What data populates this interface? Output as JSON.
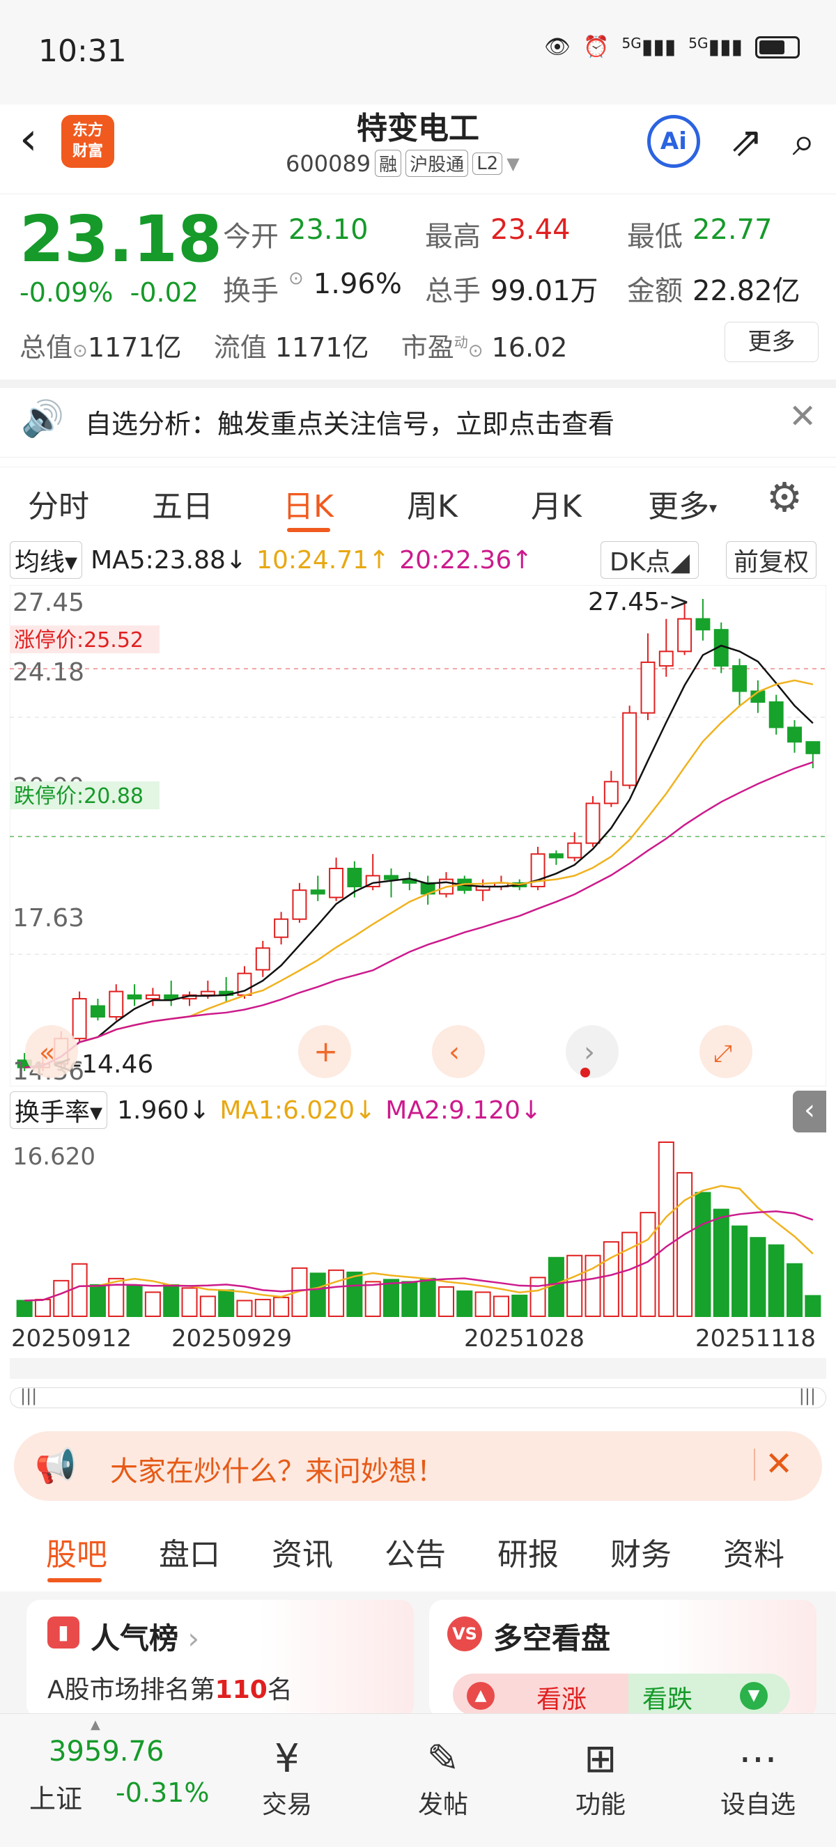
{
  "status": {
    "time": "10:31",
    "signal1": "5G",
    "signal2": "5G"
  },
  "header": {
    "logo_line1": "东方",
    "logo_line2": "财富",
    "title": "特变电工",
    "code": "600089",
    "tags": [
      "融",
      "沪股通",
      "L2"
    ],
    "ai_label": "Ai"
  },
  "quote": {
    "price": "23.18",
    "change_pct": "-0.09%",
    "change": "-0.02",
    "open_label": "今开",
    "open": "23.10",
    "high_label": "最高",
    "high": "23.44",
    "low_label": "最低",
    "low": "22.77",
    "turnover_label": "换手",
    "turnover": "1.96%",
    "volume_label": "总手",
    "volume": "99.01万",
    "amount_label": "金额",
    "amount": "22.82亿",
    "mktcap_label": "总值",
    "mktcap": "1171亿",
    "float_label": "流值",
    "float": "1171亿",
    "pe_label": "市盈",
    "pe_sup": "动",
    "pe": "16.02",
    "more_label": "更多"
  },
  "analysis": {
    "text": "自选分析：触发重点关注信号，立即点击查看"
  },
  "tabs": [
    "分时",
    "五日",
    "日K",
    "周K",
    "月K",
    "更多"
  ],
  "active_tab": "日K",
  "ma_bar": {
    "type": "均线",
    "ma5": "MA5:23.88",
    "ma10": "10:24.71",
    "ma20": "20:22.36",
    "dk": "DK点",
    "adj": "前复权"
  },
  "kchart": {
    "y_labels": [
      "27.45",
      "24.18",
      "20.90",
      "17.63",
      "14.36"
    ],
    "limit_up": "涨停价:25.52",
    "limit_down": "跌停价:20.88",
    "max_marker": "27.45->",
    "min_marker": "<-14.46",
    "colors": {
      "up": "#e02020",
      "down": "#17a22b",
      "ma5": "#111111",
      "ma10": "#f0b21e",
      "ma20": "#cc1a8c"
    }
  },
  "volume": {
    "type": "换手率",
    "value": "1.960",
    "ma1": "MA1:6.020",
    "ma2": "MA2:9.120",
    "max_label": "16.620"
  },
  "dates": [
    "20250912",
    "20250929",
    "20251028",
    "20251118"
  ],
  "banner": {
    "text": "大家在炒什么？来问妙想！"
  },
  "guba_tabs": [
    "股吧",
    "盘口",
    "资讯",
    "公告",
    "研报",
    "财务",
    "资料"
  ],
  "cards": {
    "popularity": {
      "title": "人气榜",
      "text_prefix": "A股市场排名第",
      "rank": "110",
      "text_suffix": "名"
    },
    "duokong": {
      "title": "多空看盘",
      "up": "看涨",
      "down": "看跌"
    }
  },
  "bottom": {
    "index_value": "3959.76",
    "index_name": "上证",
    "index_change": "-0.31%",
    "items": [
      "交易",
      "发帖",
      "功能",
      "设自选"
    ]
  },
  "chart_data": {
    "type": "candlestick",
    "candles": [
      [
        14.7,
        14.5,
        14.9,
        14.4
      ],
      [
        14.5,
        14.6,
        14.8,
        14.4
      ],
      [
        14.6,
        15.3,
        15.5,
        14.5
      ],
      [
        15.3,
        16.4,
        16.6,
        15.2
      ],
      [
        16.2,
        15.9,
        16.4,
        15.8
      ],
      [
        15.9,
        16.6,
        16.8,
        15.8
      ],
      [
        16.5,
        16.4,
        16.8,
        16.2
      ],
      [
        16.4,
        16.5,
        16.7,
        16.2
      ],
      [
        16.5,
        16.4,
        16.9,
        16.2
      ],
      [
        16.4,
        16.5,
        16.6,
        16.2
      ],
      [
        16.5,
        16.6,
        16.9,
        16.4
      ],
      [
        16.6,
        16.5,
        17.0,
        16.3
      ],
      [
        16.5,
        17.1,
        17.3,
        16.4
      ],
      [
        17.2,
        17.8,
        18.0,
        17.0
      ],
      [
        18.1,
        18.6,
        18.8,
        17.9
      ],
      [
        18.6,
        19.4,
        19.6,
        18.5
      ],
      [
        19.4,
        19.3,
        19.8,
        19.1
      ],
      [
        19.2,
        20.0,
        20.3,
        19.1
      ],
      [
        20.0,
        19.5,
        20.2,
        19.2
      ],
      [
        19.5,
        19.8,
        20.4,
        19.4
      ],
      [
        19.8,
        19.7,
        20.0,
        19.2
      ],
      [
        19.7,
        19.6,
        19.9,
        19.4
      ],
      [
        19.6,
        19.3,
        19.8,
        19.0
      ],
      [
        19.3,
        19.7,
        19.9,
        19.2
      ],
      [
        19.7,
        19.4,
        19.8,
        19.3
      ],
      [
        19.4,
        19.5,
        19.7,
        19.1
      ],
      [
        19.5,
        19.6,
        19.8,
        19.4
      ],
      [
        19.6,
        19.5,
        19.7,
        19.4
      ],
      [
        19.5,
        20.4,
        20.6,
        19.4
      ],
      [
        20.4,
        20.3,
        20.5,
        20.1
      ],
      [
        20.3,
        20.7,
        21.0,
        20.2
      ],
      [
        20.7,
        21.8,
        22.0,
        20.6
      ],
      [
        21.8,
        22.4,
        22.7,
        21.7
      ],
      [
        22.3,
        24.3,
        24.5,
        22.2
      ],
      [
        24.3,
        25.7,
        26.5,
        24.1
      ],
      [
        25.6,
        26.0,
        26.9,
        25.3
      ],
      [
        26.0,
        26.9,
        27.4,
        25.9
      ],
      [
        26.9,
        26.6,
        27.45,
        26.3
      ],
      [
        26.6,
        25.6,
        26.8,
        25.4
      ],
      [
        25.6,
        24.9,
        25.8,
        24.5
      ],
      [
        24.9,
        24.6,
        25.2,
        24.3
      ],
      [
        24.6,
        23.9,
        24.8,
        23.7
      ],
      [
        23.9,
        23.5,
        24.1,
        23.2
      ],
      [
        23.5,
        23.18,
        23.44,
        22.77
      ]
    ],
    "turnover": [
      1.5,
      1.6,
      3.4,
      5.0,
      3.0,
      3.6,
      2.9,
      2.3,
      3.0,
      2.7,
      1.9,
      2.5,
      1.5,
      1.6,
      1.8,
      4.6,
      4.1,
      4.4,
      4.2,
      3.3,
      3.5,
      3.3,
      3.6,
      2.8,
      2.4,
      2.3,
      1.9,
      2.0,
      3.7,
      5.6,
      5.8,
      5.8,
      7.1,
      8.0,
      9.9,
      16.62,
      13.7,
      11.8,
      10.2,
      8.6,
      7.5,
      6.8,
      5.0,
      1.96
    ],
    "ylim": [
      14.36,
      27.45
    ]
  }
}
